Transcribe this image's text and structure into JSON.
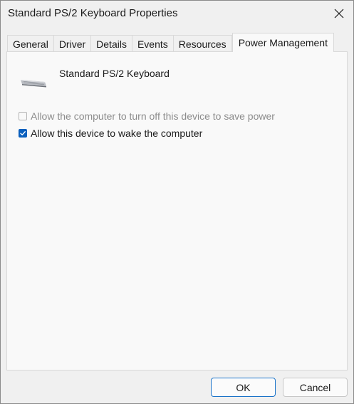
{
  "window": {
    "title": "Standard PS/2 Keyboard Properties"
  },
  "tabs": [
    {
      "label": "General"
    },
    {
      "label": "Driver"
    },
    {
      "label": "Details"
    },
    {
      "label": "Events"
    },
    {
      "label": "Resources"
    },
    {
      "label": "Power Management",
      "active": true
    }
  ],
  "device": {
    "name": "Standard PS/2 Keyboard",
    "icon": "keyboard-icon"
  },
  "options": {
    "allow_turn_off": {
      "label": "Allow the computer to turn off this device to save power",
      "checked": false,
      "enabled": false
    },
    "allow_wake": {
      "label": "Allow this device to wake the computer",
      "checked": true,
      "enabled": true
    }
  },
  "buttons": {
    "ok": "OK",
    "cancel": "Cancel"
  },
  "colors": {
    "accent": "#0a5fbd",
    "default_button_border": "#1a73c8"
  }
}
